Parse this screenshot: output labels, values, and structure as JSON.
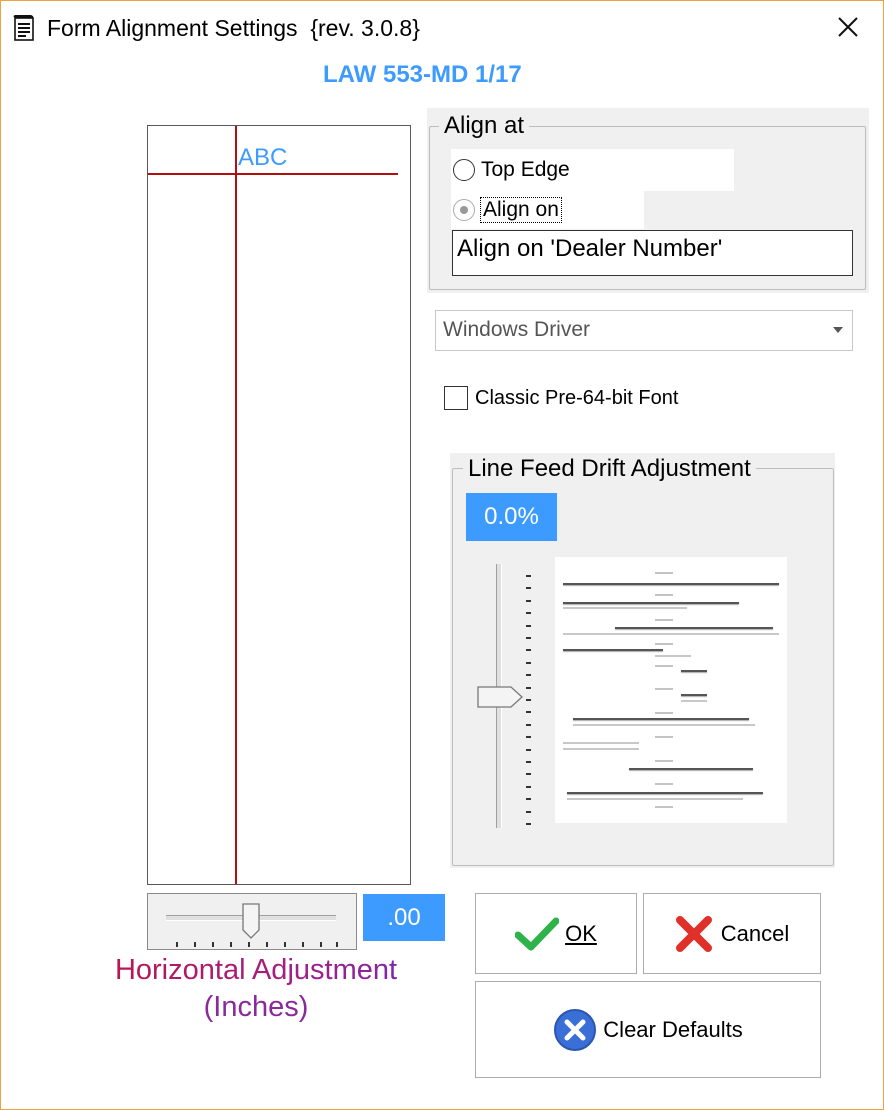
{
  "window": {
    "title": "Form Alignment Settings  {rev. 3.0.8}",
    "form_id": "LAW 553-MD 1/17"
  },
  "preview": {
    "sample_text": "ABC"
  },
  "horizontal": {
    "value": ".00",
    "label_line1": "Horizontal Adjustment",
    "label_line2": "(Inches)"
  },
  "align_at": {
    "legend": "Align at",
    "options": [
      {
        "label": "Top Edge",
        "selected": false
      },
      {
        "label": "Align on",
        "selected": true
      }
    ],
    "field_value": "Align on 'Dealer Number'"
  },
  "driver": {
    "selected": "Windows Driver"
  },
  "classic_font": {
    "label": "Classic Pre-64-bit Font",
    "checked": false
  },
  "line_feed": {
    "legend": "Line Feed Drift Adjustment",
    "value": "0.0%"
  },
  "buttons": {
    "ok_label": "OK",
    "cancel_label": "Cancel",
    "clear_label": "Clear Defaults"
  },
  "colors": {
    "accent": "#3d9bff",
    "guide_line": "#b01010",
    "ok_green": "#2db34a",
    "cancel_red": "#e0302a",
    "clear_blue": "#3a6fd8"
  },
  "icons": [
    "document-icon",
    "close-icon",
    "check-icon",
    "x-icon",
    "clear-circle-icon"
  ]
}
